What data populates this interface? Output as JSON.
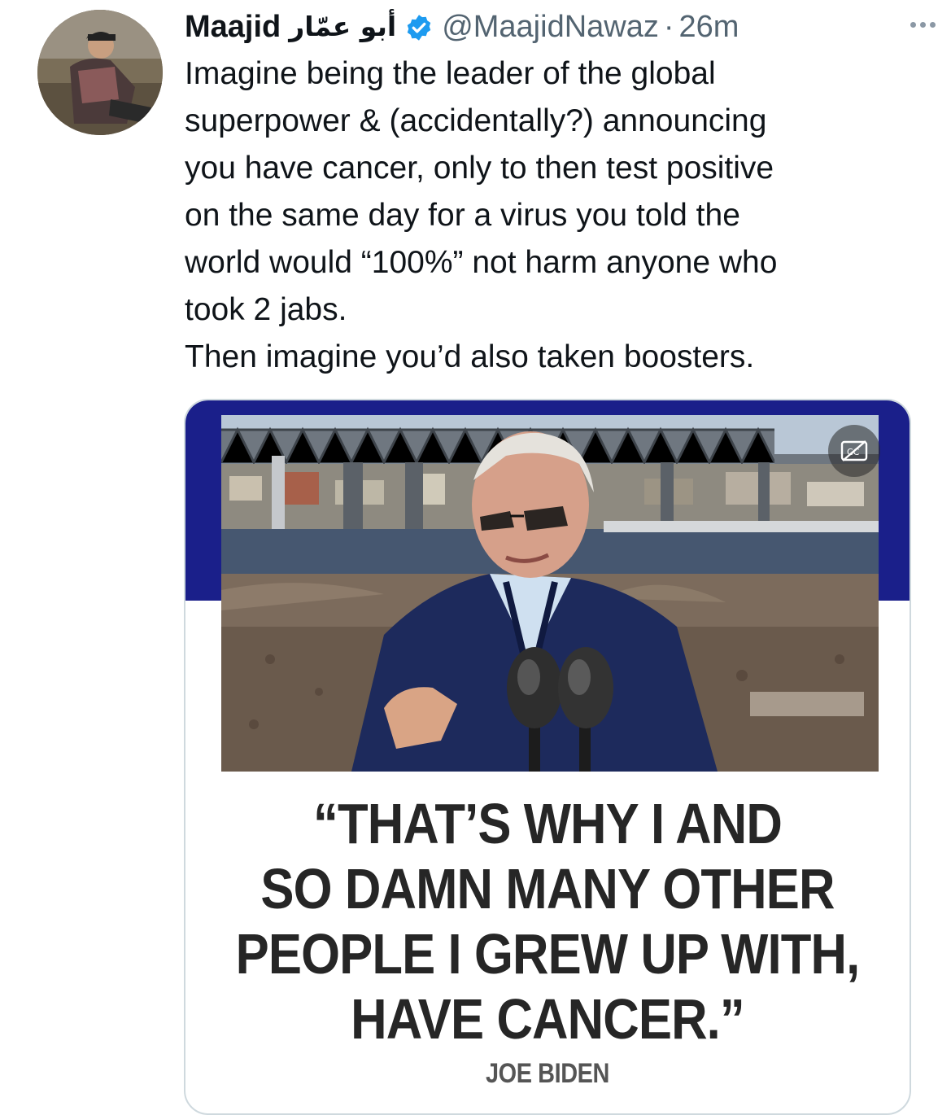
{
  "tweet": {
    "display_name": "Maajid",
    "arabic_name": "أبو عمّار",
    "handle": "@MaajidNawaz",
    "separator": "·",
    "timestamp": "26m",
    "verified": true,
    "text_lines": [
      "Imagine being the leader of the global",
      "superpower & (accidentally?) announcing",
      "you have cancer, only to then test positive",
      "on the same day for a virus you told the",
      "world would “100%” not harm anyone who",
      "took 2 jabs.",
      "Then imagine you’d also taken boosters."
    ]
  },
  "media": {
    "quote_lines": [
      "“THAT’S WHY I AND",
      "SO DAMN MANY OTHER",
      "PEOPLE I GREW UP WITH,",
      "HAVE CANCER.”"
    ],
    "attribution": "JOE BIDEN",
    "band_color": "#1a1f8a"
  },
  "icons": {
    "verified": "verified-badge-icon",
    "more": "more-options-icon",
    "captions": "closed-captions-icon"
  },
  "colors": {
    "text": "#0f1419",
    "secondary": "#536471",
    "verified": "#1d9bf0"
  }
}
